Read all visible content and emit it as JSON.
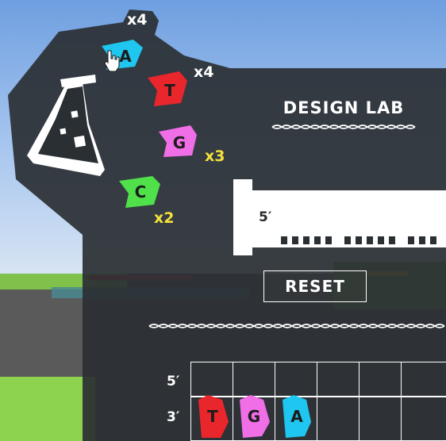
{
  "title": "DESIGN LAB",
  "reset_label": "RESET",
  "ruler_label": "5′",
  "grid": {
    "top_label": "5′",
    "bottom_label": "3′",
    "strand_pieces": [
      {
        "letter": "T",
        "color": "#e8262c"
      },
      {
        "letter": "G",
        "color": "#f06ee6"
      },
      {
        "letter": "A",
        "color": "#1ec6f0"
      }
    ]
  },
  "nucleotides": [
    {
      "letter": "A",
      "count": "x4",
      "color": "#1ec6f0",
      "count_color": "#ffffff"
    },
    {
      "letter": "T",
      "count": "x4",
      "color": "#e8262c",
      "count_color": "#ffffff"
    },
    {
      "letter": "G",
      "count": "x3",
      "color": "#f06ee6",
      "count_color": "#f3e23a"
    },
    {
      "letter": "C",
      "count": "x2",
      "color": "#4fe04a",
      "count_color": "#f3e23a"
    }
  ],
  "icons": [
    "flask-icon",
    "hand-cursor-icon",
    "dna-helix-icon"
  ]
}
